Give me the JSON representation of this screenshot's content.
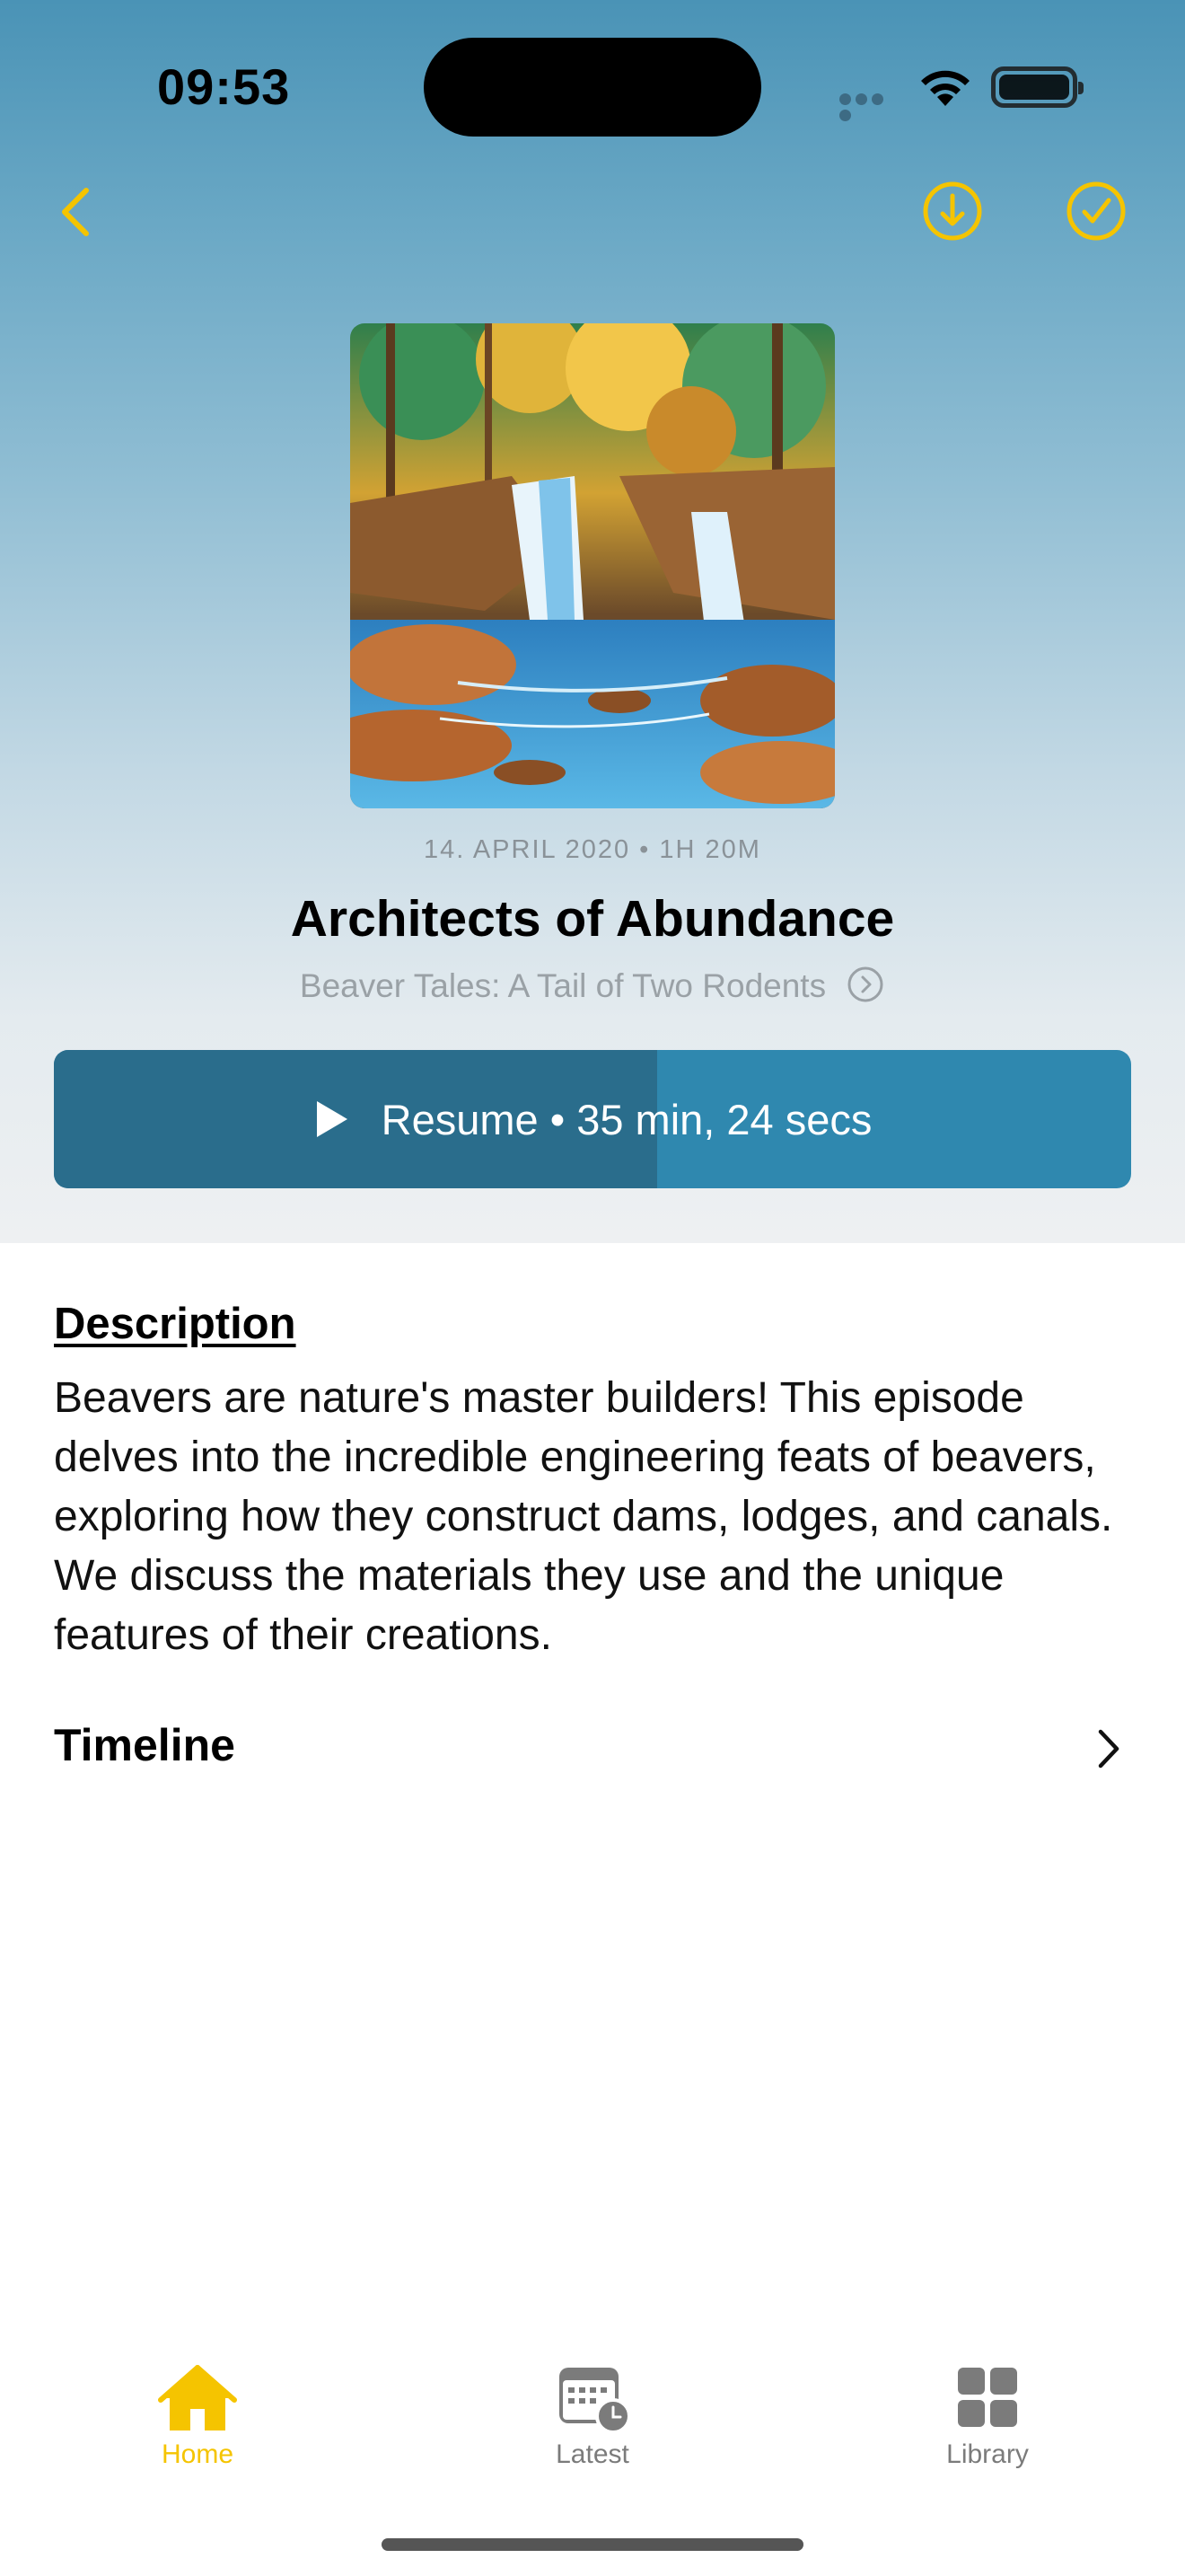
{
  "status_bar": {
    "time": "09:53"
  },
  "nav": {
    "back_icon": "chevron-left-icon",
    "download_icon": "download-circle-icon",
    "played_icon": "checkmark-circle-icon",
    "accent_color": "#f5c400"
  },
  "episode": {
    "meta": "14. APRIL 2020 • 1H 20M",
    "title": "Architects of Abundance",
    "show_name": "Beaver Tales: A Tail of Two Rodents",
    "artwork_icon": "waterfall-artwork"
  },
  "resume_button": {
    "label": "Resume • 35 min, 24 secs",
    "progress_fraction": 0.56,
    "color": "#2f88af",
    "progress_color": "#2a6d8c"
  },
  "description": {
    "heading": "Description",
    "text": "Beavers are nature's master builders! This episode delves into the incredible engineering feats of beavers, exploring how they construct dams, lodges, and canals. We discuss the materials they use and the unique features of their creations."
  },
  "timeline": {
    "label": "Timeline"
  },
  "tab_bar": {
    "tabs": [
      {
        "label": "Home",
        "icon": "house-icon",
        "active": true
      },
      {
        "label": "Latest",
        "icon": "calendar-clock-icon",
        "active": false
      },
      {
        "label": "Library",
        "icon": "grid-icon",
        "active": false
      }
    ]
  }
}
